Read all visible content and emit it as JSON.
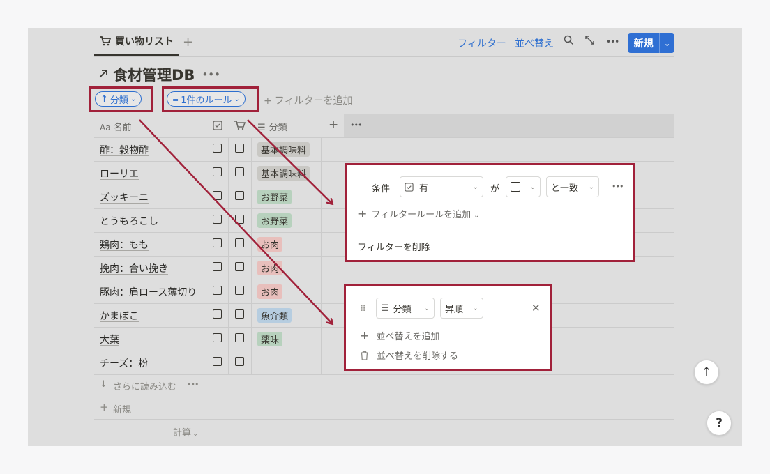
{
  "tab": {
    "icon": "cart-icon",
    "label": "買い物リスト",
    "add": "+"
  },
  "toolbar": {
    "filter": "フィルター",
    "sort": "並べ替え",
    "new_label": "新規"
  },
  "db": {
    "title": "食材管理DB",
    "more": "•••"
  },
  "chips": {
    "sort_chip": "分類",
    "filter_chip": "1件のルール",
    "add_filter": "フィルターを追加"
  },
  "columns": {
    "name": "名前",
    "name_prefix": "Aa",
    "category": "分類",
    "add": "+",
    "more": "•••"
  },
  "rows": [
    {
      "name": "酢：穀物酢",
      "tag": "基本調味料",
      "tag_color": "#c9c8c4",
      "check_col": false,
      "cart_col": false
    },
    {
      "name": "ローリエ",
      "tag": "基本調味料",
      "tag_color": "#c9c8c4",
      "check_col": false,
      "cart_col": false
    },
    {
      "name": "ズッキーニ",
      "tag": "お野菜",
      "tag_color": "#b7d1bd",
      "check_col": false,
      "cart_col": false
    },
    {
      "name": "とうもろこし",
      "tag": "お野菜",
      "tag_color": "#b7d1bd",
      "check_col": false,
      "cart_col": false
    },
    {
      "name": "鶏肉：もも",
      "tag": "お肉",
      "tag_color": "#e8bfbc",
      "check_col": false,
      "cart_col": false
    },
    {
      "name": "挽肉：合い挽き",
      "tag": "お肉",
      "tag_color": "#e8bfbc",
      "check_col": false,
      "cart_col": false
    },
    {
      "name": "豚肉：肩ロース薄切り",
      "tag": "お肉",
      "tag_color": "#e8bfbc",
      "check_col": false,
      "cart_col": false
    },
    {
      "name": "かまぼこ",
      "tag": "魚介類",
      "tag_color": "#b6cde0",
      "check_col": false,
      "cart_col": false
    },
    {
      "name": "大葉",
      "tag": "薬味",
      "tag_color": "#b7d1bd",
      "check_col": false,
      "cart_col": false
    },
    {
      "name": "チーズ：粉",
      "tag": "",
      "tag_color": "",
      "check_col": false,
      "cart_col": false
    }
  ],
  "footer": {
    "load_more": "さらに読み込む",
    "new_row": "新規",
    "calc": "計算"
  },
  "filter_popup": {
    "condition": "条件",
    "property": "有",
    "ga": "が",
    "match": "と一致",
    "add_rule": "フィルタールールを追加",
    "delete": "フィルターを削除"
  },
  "sort_popup": {
    "property": "分類",
    "order": "昇順",
    "add": "並べ替えを追加",
    "delete": "並べ替えを削除する"
  },
  "side_buttons": {
    "up": "↑",
    "help": "?"
  },
  "colors": {
    "accent": "#2e6fcf",
    "highlight": "#a1213a",
    "new_button": "#2f6fd3"
  }
}
